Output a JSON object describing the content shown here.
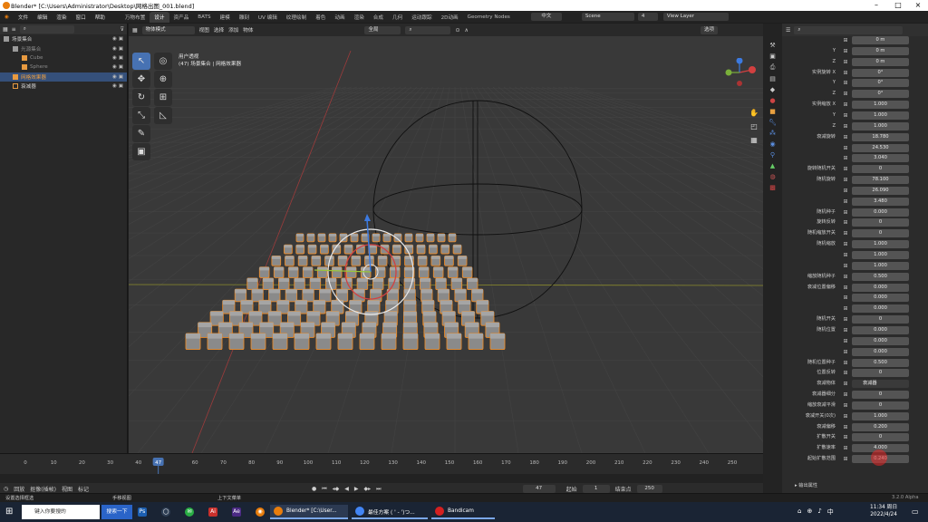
{
  "window": {
    "title": "Blender* [C:\\Users\\Administrator\\Desktop\\网格出图_001.blend]"
  },
  "menu": {
    "items": [
      "文件",
      "编辑",
      "渲染",
      "窗口",
      "帮助"
    ],
    "tabs": [
      "万物布置",
      "设计",
      "资产品",
      "BATS",
      "建模",
      "雕刻",
      "UV 编辑",
      "纹理绘制",
      "着色",
      "动画",
      "渲染",
      "合成",
      "几何",
      "运动跟踪",
      "2D动画",
      "Geometry Nodes"
    ],
    "active_tab": "设计",
    "lang": "中文",
    "scene_label": "Scene",
    "view_layer_label": "View Layer",
    "scene_num": "4"
  },
  "outliner": {
    "items": [
      {
        "label": "场景集合",
        "depth": 0,
        "selected": false,
        "color": "#cfcfcf",
        "icon": "collection-icon"
      },
      {
        "label": "光源集合",
        "depth": 1,
        "selected": false,
        "color": "#8a8a8a",
        "icon": "collection-icon"
      },
      {
        "label": "Cube",
        "depth": 2,
        "selected": false,
        "color": "#8a8a8a",
        "icon": "mesh-icon"
      },
      {
        "label": "Sphere",
        "depth": 2,
        "selected": false,
        "color": "#8a8a8a",
        "icon": "mesh-icon"
      },
      {
        "label": "网格效果器",
        "depth": 1,
        "selected": true,
        "color": "#f0a040",
        "icon": "mesh-icon"
      },
      {
        "label": "衰减器",
        "depth": 1,
        "selected": false,
        "color": "#cfcfcf",
        "icon": "empty-icon"
      }
    ]
  },
  "viewport": {
    "header": [
      "物体模式",
      "视图",
      "选择",
      "添加",
      "物体"
    ],
    "transform_orientation": "全局",
    "options_label": "选项",
    "info_line1": "用户透视",
    "info_line2": "(47) 场景集合 | 网格效果器"
  },
  "properties": {
    "rows": [
      {
        "label": "",
        "value": "0 m"
      },
      {
        "label": "Y",
        "value": "0 m"
      },
      {
        "label": "Z",
        "value": "0 m"
      },
      {
        "label": "实例旋转 X",
        "value": "0°"
      },
      {
        "label": "Y",
        "value": "0°"
      },
      {
        "label": "Z",
        "value": "0°"
      },
      {
        "label": "实例缩放 X",
        "value": "1.000"
      },
      {
        "label": "Y",
        "value": "1.000"
      },
      {
        "label": "Z",
        "value": "1.000"
      },
      {
        "label": "衰减旋转",
        "value": "18.780"
      },
      {
        "label": "",
        "value": "24.530"
      },
      {
        "label": "",
        "value": "3.040"
      },
      {
        "label": "旋转随机开关",
        "value": "0"
      },
      {
        "label": "随机旋转",
        "value": "78.100"
      },
      {
        "label": "",
        "value": "26.090"
      },
      {
        "label": "",
        "value": "3.480"
      },
      {
        "label": "随机种子",
        "value": "0.000"
      },
      {
        "label": "旋转反转",
        "value": "0"
      },
      {
        "label": "随机缩放开关",
        "value": "0"
      },
      {
        "label": "随机缩放",
        "value": "1.000"
      },
      {
        "label": "",
        "value": "1.000"
      },
      {
        "label": "",
        "value": "1.000"
      },
      {
        "label": "缩放随机种子",
        "value": "0.500"
      },
      {
        "label": "衰减位置偏移",
        "value": "0.000"
      },
      {
        "label": "",
        "value": "0.000"
      },
      {
        "label": "",
        "value": "0.000"
      },
      {
        "label": "随机开关",
        "value": "0"
      },
      {
        "label": "随机位置",
        "value": "0.000"
      },
      {
        "label": "",
        "value": "0.000"
      },
      {
        "label": "",
        "value": "0.000"
      },
      {
        "label": "随机位置种子",
        "value": "0.500"
      },
      {
        "label": "位置反转",
        "value": "0"
      },
      {
        "label": "衰减物体",
        "value": "衰减器"
      },
      {
        "label": "衰减器细分",
        "value": "0"
      },
      {
        "label": "缩放衰减平滑",
        "value": "0"
      },
      {
        "label": "衰减开关(0次)",
        "value": "1.000"
      },
      {
        "label": "衰减偏移",
        "value": "0.200"
      },
      {
        "label": "扩散开关",
        "value": "0"
      },
      {
        "label": "扩散速率",
        "value": "4.000"
      },
      {
        "label": "起始扩散范围",
        "value": "0.240"
      }
    ],
    "footer": "输出属性"
  },
  "timeline": {
    "ticks": [
      "0",
      "10",
      "20",
      "30",
      "40",
      "47",
      "60",
      "70",
      "80",
      "90",
      "100",
      "110",
      "120",
      "130",
      "140",
      "150",
      "160",
      "170",
      "180",
      "190",
      "200",
      "210",
      "220",
      "230",
      "240",
      "250"
    ],
    "current_frame": "47",
    "start_label": "起始",
    "start_value": "1",
    "end_label": "结束点",
    "end_value": "250",
    "menu": [
      "回放",
      "抠像(插帧)",
      "视图",
      "标记"
    ]
  },
  "statusbar": {
    "left": "设置选择框选",
    "mid": "手移视图",
    "right": "上下文菜单",
    "version": "3.2.0 Alpha"
  },
  "taskbar": {
    "search": "键入你要搜的",
    "search_btn": "搜索一下",
    "apps": [
      {
        "label": "Blender* [C:\\User...",
        "color": "#e87d0d",
        "icon": "blender-icon"
      },
      {
        "label": "最佳方案 ( ' - ')つ...",
        "color": "#4285f4",
        "icon": "chrome-icon"
      },
      {
        "label": "Bandicam",
        "color": "#d42020",
        "icon": "bandicam-icon"
      }
    ],
    "time": "11:34 周日",
    "date": "2022/4/24"
  },
  "colors": {
    "accent": "#4772b3",
    "selected_orange": "#f0a040"
  }
}
